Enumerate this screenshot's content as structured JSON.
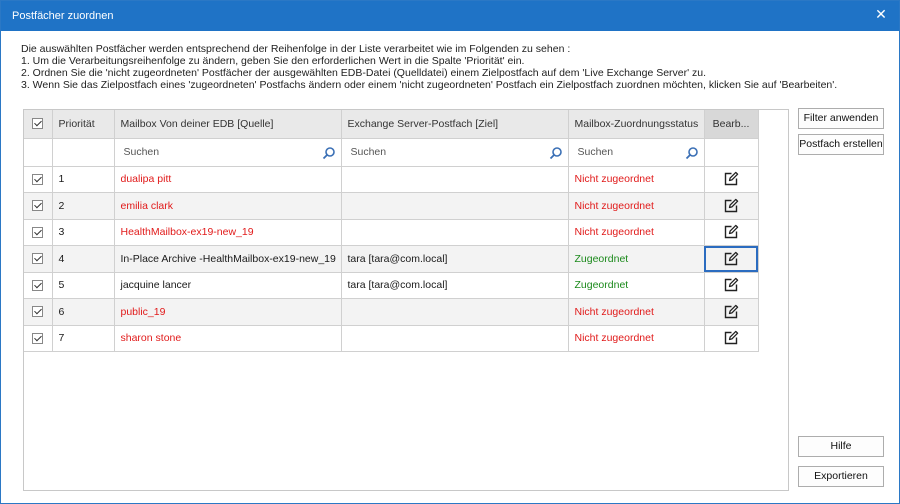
{
  "window": {
    "title": "Postfächer zuordnen",
    "close_label": "✕"
  },
  "instructions": [
    "Die auswählten Postfächer werden entsprechend der Reihenfolge in der Liste verarbeitet wie im Folgenden zu sehen :",
    "1. Um die Verarbeitungsreihenfolge zu ändern, geben Sie den erforderlichen Wert in die Spalte 'Priorität' ein.",
    "2. Ordnen Sie die 'nicht zugeordneten' Postfächer der ausgewählten EDB-Datei (Quelldatei) einem Zielpostfach auf dem 'Live Exchange Server' zu.",
    "3. Wenn Sie das Zielpostfach eines 'zugeordneten' Postfachs ändern oder einem 'nicht zugeordneten' Postfach ein Zielpostfach zuordnen möchten, klicken Sie auf 'Bearbeiten'."
  ],
  "table": {
    "headers": {
      "priority": "Priorität",
      "source": "Mailbox Von deiner EDB [Quelle]",
      "target": "Exchange Server-Postfach [Ziel]",
      "status": "Mailbox-Zuordnungsstatus",
      "edit": "Bearb..."
    },
    "search_placeholder": "Suchen",
    "rows": [
      {
        "priority": "1",
        "source": "dualipa pitt",
        "target": "",
        "status": "Nicht zugeordnet",
        "mapped": false
      },
      {
        "priority": "2",
        "source": "emilia clark",
        "target": "",
        "status": "Nicht zugeordnet",
        "mapped": false
      },
      {
        "priority": "3",
        "source": "HealthMailbox-ex19-new_19",
        "target": "",
        "status": "Nicht zugeordnet",
        "mapped": false
      },
      {
        "priority": "4",
        "source": "In-Place Archive -HealthMailbox-ex19-new_19",
        "target": "tara [tara@com.local]",
        "status": "Zugeordnet",
        "mapped": true
      },
      {
        "priority": "5",
        "source": "jacquine lancer",
        "target": "tara [tara@com.local]",
        "status": "Zugeordnet",
        "mapped": true
      },
      {
        "priority": "6",
        "source": "public_19",
        "target": "",
        "status": "Nicht zugeordnet",
        "mapped": false
      },
      {
        "priority": "7",
        "source": "sharon stone",
        "target": "",
        "status": "Nicht zugeordnet",
        "mapped": false
      }
    ]
  },
  "buttons": {
    "filter": "Filter anwenden",
    "create": "Postfach erstellen",
    "help": "Hilfe",
    "export": "Exportieren"
  },
  "colors": {
    "titlebar": "#1f73c6",
    "unmapped": "#e11a1a",
    "mapped": "#1c8a1c"
  },
  "icons": {
    "close": "close-icon",
    "search": "search-icon",
    "edit": "edit-icon",
    "checkbox": "checkbox-checked"
  }
}
